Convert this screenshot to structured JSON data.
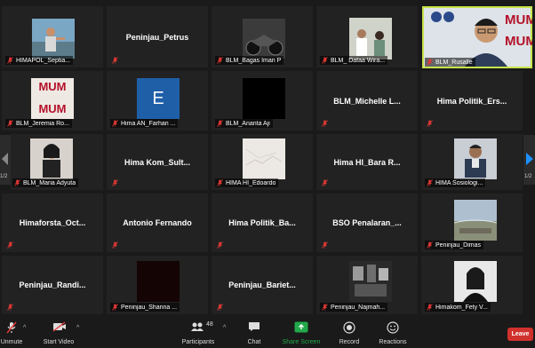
{
  "meeting": {
    "page_indicator_left": "1/2",
    "page_indicator_right": "1/2"
  },
  "colors": {
    "active_speaker_border": "#c7e34a",
    "muted_red": "#e53935",
    "leave_red": "#d0312d",
    "share_green": "#23a84a",
    "tile_bg": "#222222"
  },
  "tiles": [
    {
      "label": "HIMAPOL_Septia..."
    },
    {
      "center": "Peninjau_Petrus"
    },
    {
      "label": "BLM_Bagas Iman P"
    },
    {
      "label": "BLM_ Dafaa Wira..."
    },
    {
      "label": "BLM_Rusalle",
      "watermark_top": "MUM",
      "watermark_bottom": "MUM"
    },
    {
      "label": "BLM_Jeremia Ro...",
      "logo_top": "MUM",
      "logo_bottom": "MUM"
    },
    {
      "label": "Hima AN_Farhan ...",
      "avatar_letter": "E"
    },
    {
      "label": "BLM_Ananta Aji"
    },
    {
      "center": "BLM_Michelle  L..."
    },
    {
      "center": "Hima  Politik_Ers..."
    },
    {
      "label": "BLM_Maria Adyuta"
    },
    {
      "center": "Hima  Kom_Sult..."
    },
    {
      "label": "HIMA HI_Edoardo"
    },
    {
      "center": "Hima  HI_Bara R..."
    },
    {
      "label": "HIMA Sosiologi..."
    },
    {
      "center": "Himaforsta_Oct..."
    },
    {
      "center": "Antonio Fernando"
    },
    {
      "center": "Hima  Politik_Ba..."
    },
    {
      "center": "BSO  Penalaran_..."
    },
    {
      "label": "Peninjau_Dimas"
    },
    {
      "center": "Peninjau_Randi..."
    },
    {
      "label": "Peninjau_Shanna ..."
    },
    {
      "center": "Peninjau_Bariet..."
    },
    {
      "label": "Peninjau_Najmah..."
    },
    {
      "label": "Himakom_Fety V..."
    }
  ],
  "toolbar": {
    "unmute": "Unmute",
    "start_video": "Start Video",
    "participants": "Participants",
    "participants_count": "48",
    "chat": "Chat",
    "share_screen": "Share Screen",
    "record": "Record",
    "reactions": "Reactions",
    "leave": "Leave"
  },
  "icons": [
    "microphone-muted-icon",
    "video-off-icon",
    "participants-icon",
    "chat-icon",
    "share-screen-icon",
    "record-icon",
    "reactions-icon",
    "caret-up-icon",
    "arrow-left-icon",
    "arrow-right-icon"
  ]
}
